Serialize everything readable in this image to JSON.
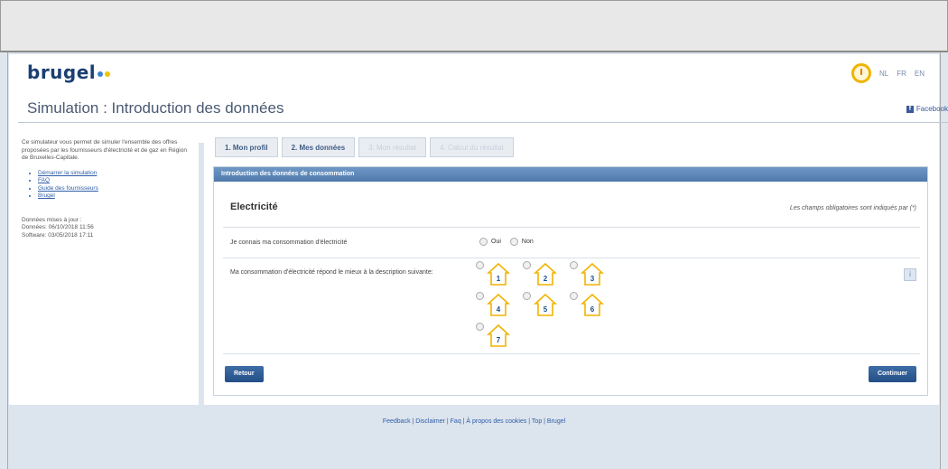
{
  "header": {
    "logo_text": "brugel",
    "logo_dot_colors": [
      "#3a86d6",
      "#f2c200"
    ],
    "languages": [
      "NL",
      "FR",
      "EN"
    ],
    "page_title": "Simulation : Introduction des données",
    "facebook_label": "Facebook"
  },
  "sidebar": {
    "intro": "Ce simulateur vous permet de simuler l'ensemble des offres proposées par les fournisseurs d'électricité et de gaz en Région de Bruxelles-Capitale.",
    "links": [
      "Démarrer la simulation",
      "FAQ",
      "Guide des fournisseurs",
      "Brugel"
    ],
    "update_title": "Données mises à jour :",
    "update_1": "Données: 06/10/2018 11:56",
    "update_2": "Software: 03/05/2018 17:11"
  },
  "tabs": [
    {
      "label": "1. Mon profil"
    },
    {
      "label": "2. Mes données"
    },
    {
      "label": "3. Mon résultat"
    },
    {
      "label": "4. Calcul du résultat"
    }
  ],
  "panel": {
    "header": "Introduction des données de consommation",
    "section_title": "Electricité",
    "mandatory_note": "Les champs obligatoires sont indiqués par (*)",
    "q1_label": "Je connais ma consommation d'électricité",
    "option_yes": "Oui",
    "option_no": "Non",
    "q2_label": "Ma consommation d'électricité répond le mieux à la description suivante:",
    "house_labels": [
      "1",
      "2",
      "3",
      "4",
      "5",
      "6",
      "7"
    ],
    "info_symbol": "i",
    "reset_label": "Retour",
    "continue_label": "Continuer"
  },
  "footer": {
    "text": "Feedback | Disclaimer | Faq | À propos des cookies | Top | Brugel"
  },
  "colors": {
    "brand": "#1b3f72",
    "accent": "#f1b400",
    "button": "#2c5a93"
  }
}
